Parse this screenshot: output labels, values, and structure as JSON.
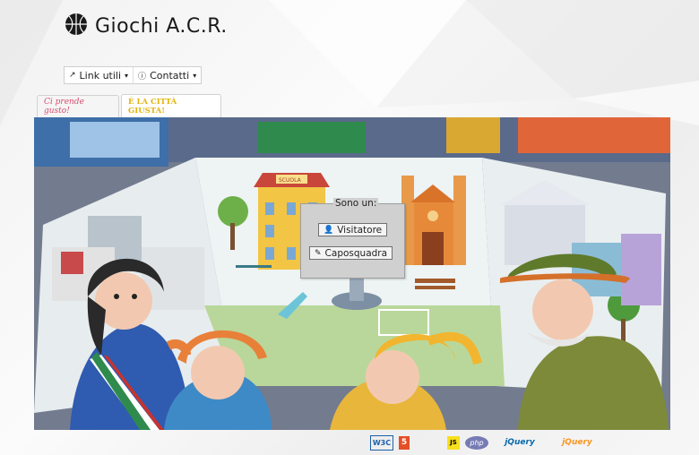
{
  "header": {
    "title": "Giochi A.C.R.",
    "logo_icon": "basketball-icon"
  },
  "menu": {
    "items": [
      {
        "label": "Link utili",
        "icon": "external-link-icon"
      },
      {
        "label": "Contatti",
        "icon": "info-icon"
      }
    ]
  },
  "tabs": [
    {
      "label": "Ci prende gusto!",
      "active": false
    },
    {
      "label": "È LA CITTÀ GIUSTA!",
      "active": true
    }
  ],
  "banner": {
    "school_sign": "SCUOLA"
  },
  "popup": {
    "legend": "Sono un:",
    "buttons": [
      {
        "label": "Visitatore",
        "icon": "user-icon"
      },
      {
        "label": "Caposquadra",
        "icon": "pencil-icon"
      }
    ]
  },
  "footer": {
    "badges": [
      "W3C",
      "5",
      "JS",
      "php",
      "jQuery",
      "jQuery"
    ],
    "colors": {
      "w3c": "#1b5eaa",
      "html5": "#e34f26",
      "js": "#f7df1e",
      "php": "#777bb4",
      "jquery": "#0769ad",
      "jqueryui": "#f89520"
    }
  }
}
